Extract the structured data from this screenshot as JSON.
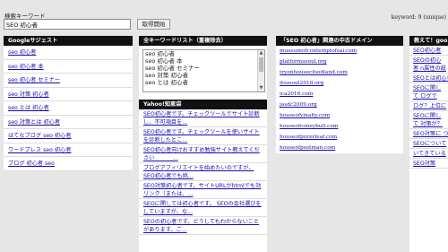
{
  "search": {
    "label": "検索キーワード",
    "value": "SEO 初心者",
    "button_label": "取得開始"
  },
  "keyword_count": "keyword: 9 (unique)",
  "google": {
    "header": "Googleサジェスト",
    "items": [
      "seo 初心者",
      "seo 初心者 本",
      "seo 初心者 セミナー",
      "seo 対策 初心者",
      "seo とは 初心者",
      "seo 対策とは 初心者",
      "はてなブログ seo 初心者",
      "ワードプレス seo 初心者",
      "ブログ 初心者 seo"
    ]
  },
  "all_keywords": {
    "header": "全キーワードリスト（重複除去）",
    "lines": [
      "seo 初心者",
      "seo 初心者 本",
      "seo 初心者 セミナー",
      "seo 対策 初心者",
      "seo とは 初心者"
    ]
  },
  "yahoo": {
    "header": "Yahoo!知恵袋",
    "items": [
      "SEO初心者です。チェックツールでサイト診断し、不可項目を...",
      "SEO初心者です。チェックツールを使いサイトを診断したとこ...",
      "SEO初心者向けおすすめ勉強サイト教えてください　　　 ...",
      "ブログアフィリエイトを始めたいのですが、SEO初心者でも挑...",
      "SEO対策初心者です。サイトURLがhtmlでも効リンク（または、...",
      "SEOに関しては初心者です。 SEOの会社選びをしていますが、な...",
      "SEOの初心者です。どうしてもわからないことがあります。ご..."
    ]
  },
  "domains": {
    "header": "「SEO 初心者」関連の中古ドメイン",
    "items": [
      "museumofcontemptofsai.com",
      "platformseoul.org",
      "tryonhousecfoodland.com",
      "itsseoul2018.org",
      "ica2016.com",
      "jasdc2009.org",
      "houseofvinalty.com",
      "houseofconeybull.com",
      "houseofpurerleaf.com",
      "houseofpostman.com"
    ]
  },
  "teach": {
    "header": "教えて！goo",
    "items": [
      "SEO初心者",
      "SEOの初心者 n属性の設定",
      "SEOとは初心者",
      "SEOに関して ログでど...",
      "ログ？上位に",
      "SEOに関して 対策が？",
      "SEO対策に つ",
      "SEOについて",
      "いてきている",
      "SEO対策"
    ]
  }
}
